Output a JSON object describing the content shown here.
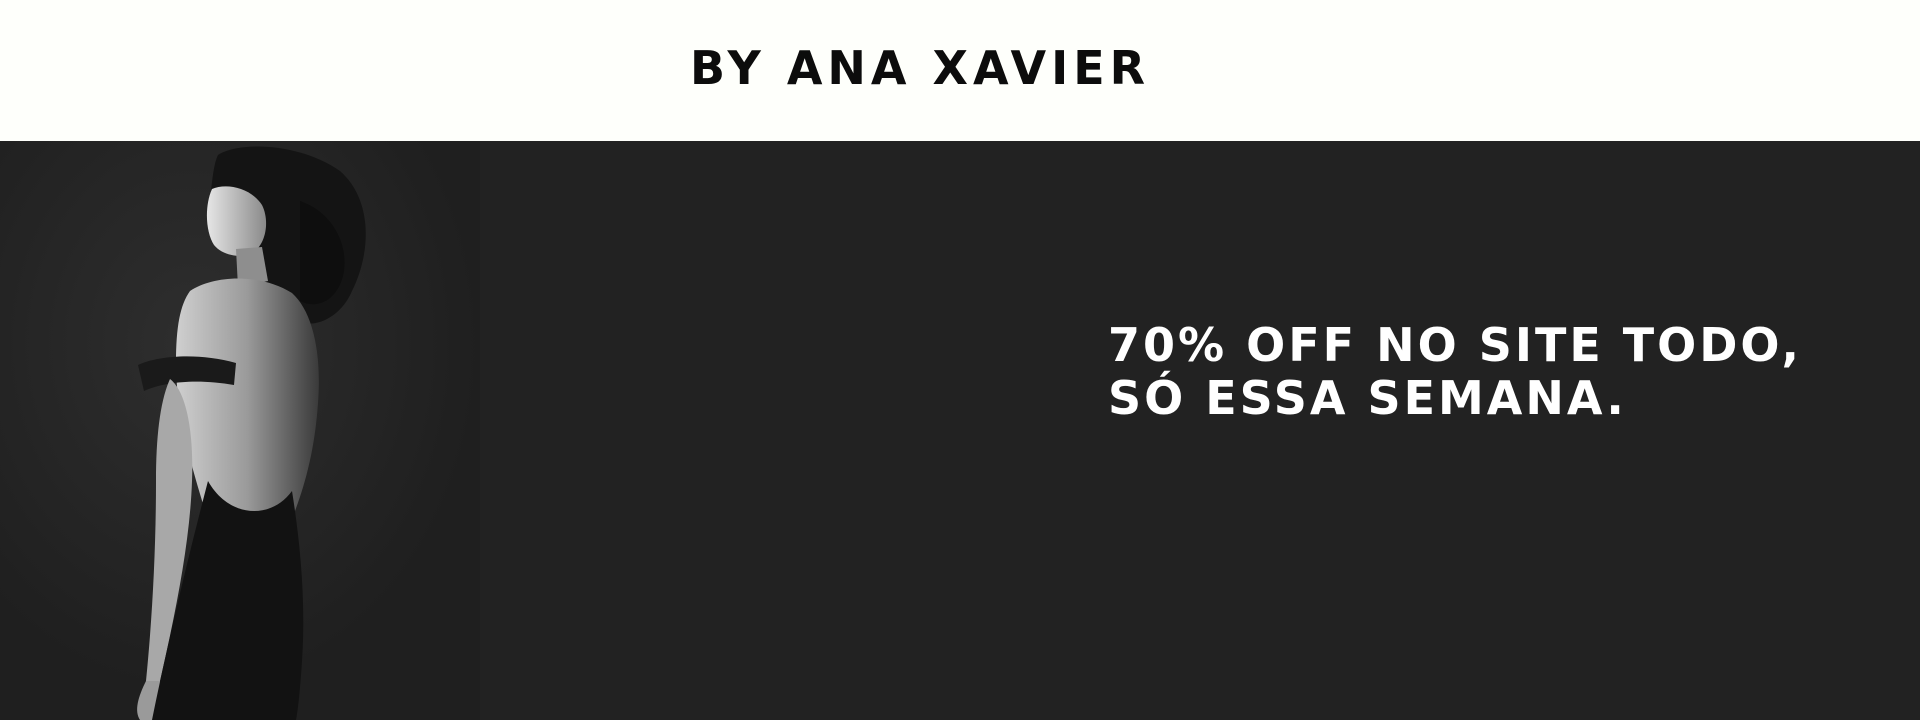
{
  "header": {
    "brand": "BY ANA XAVIER"
  },
  "hero": {
    "headline_line1": "70% OFF NO SITE TODO,",
    "headline_line2": "SÓ ESSA SEMANA.",
    "image_subject": "woman-in-backless-black-dress-portrait"
  },
  "colors": {
    "header_background": "#fefffb",
    "hero_background": "#222222",
    "brand_text": "#0c0c0c",
    "headline_text": "#ffffff"
  }
}
